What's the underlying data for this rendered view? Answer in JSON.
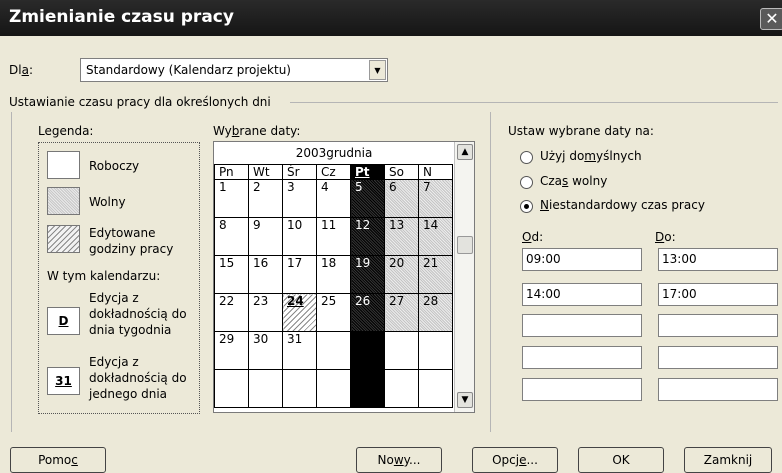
{
  "window": {
    "title": "Zmienianie czasu pracy",
    "close_glyph": "✕"
  },
  "for_field": {
    "label_pre": "Dl",
    "label_key": "a",
    "label_post": ":",
    "value": "Standardowy (Kalendarz projektu)"
  },
  "section_title": "Ustawianie czasu pracy dla określonych dni",
  "legend": {
    "title": "Legenda:",
    "working": "Roboczy",
    "nonworking": "Wolny",
    "edited_line1": "Edytowane",
    "edited_line2": "godziny pracy",
    "in_calendar": "W tym kalendarzu:",
    "weekday_letter": "D",
    "weekday_line1": "Edycja z",
    "weekday_line2": "dokładnością do",
    "weekday_line3": "dnia tygodnia",
    "day_number": "31",
    "day_line1": "Edycja z",
    "day_line2": "dokładnością do",
    "day_line3": "jednego dnia"
  },
  "selected_dates": {
    "label_pre": "Wy",
    "label_key": "b",
    "label_post": "rane daty:"
  },
  "calendar": {
    "month": "2003grudnia",
    "weekdays": [
      "Pn",
      "Wt",
      "Śr",
      "Cz",
      "Pt",
      "So",
      "N"
    ],
    "weeks": [
      [
        "1",
        "2",
        "3",
        "4",
        "5",
        "6",
        "7"
      ],
      [
        "8",
        "9",
        "10",
        "11",
        "12",
        "13",
        "14"
      ],
      [
        "15",
        "16",
        "17",
        "18",
        "19",
        "20",
        "21"
      ],
      [
        "22",
        "23",
        "24",
        "25",
        "26",
        "27",
        "28"
      ],
      [
        "29",
        "30",
        "31",
        "",
        "",
        "",
        ""
      ],
      [
        "",
        "",
        "",
        "",
        "",
        "",
        ""
      ]
    ]
  },
  "set_dates": {
    "title": "Ustaw wybrane daty na:",
    "default_pre": "Użyj do",
    "default_key": "m",
    "default_post": "yślnych",
    "nonworking_pre": "Cza",
    "nonworking_key": "s",
    "nonworking_post": " wolny",
    "custom_key": "N",
    "custom_post": "iestandardowy czas pracy",
    "from_key": "O",
    "from_post": "d:",
    "to_key": "D",
    "to_post": "o:",
    "rows": [
      {
        "from": "09:00",
        "to": "13:00"
      },
      {
        "from": "14:00",
        "to": "17:00"
      },
      {
        "from": "",
        "to": ""
      },
      {
        "from": "",
        "to": ""
      },
      {
        "from": "",
        "to": ""
      }
    ]
  },
  "buttons": {
    "help_pre": "Pomo",
    "help_key": "c",
    "new_pre": "No",
    "new_key": "w",
    "new_post": "y...",
    "options_pre": "Opcj",
    "options_key": "e",
    "options_post": "...",
    "ok": "OK",
    "close": "Zamknij"
  }
}
